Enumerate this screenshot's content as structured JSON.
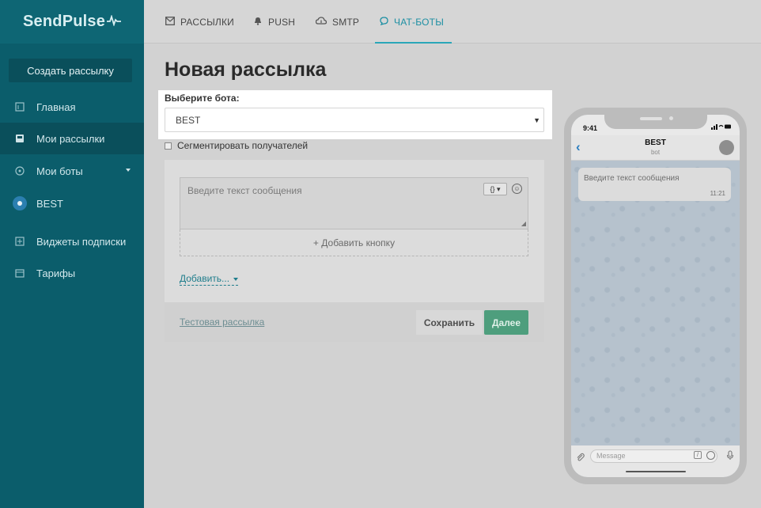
{
  "sidebar": {
    "logo": "SendPulse",
    "create_button": "Создать рассылку",
    "items": [
      {
        "label": "Главная",
        "icon": "home-icon"
      },
      {
        "label": "Мои рассылки",
        "icon": "inbox-icon",
        "active": true
      },
      {
        "label": "Мои боты",
        "icon": "bots-icon",
        "has_dropdown": true
      },
      {
        "label": "BEST",
        "icon": "bot-avatar"
      },
      {
        "label": "Виджеты подписки",
        "icon": "widget-icon"
      },
      {
        "label": "Тарифы",
        "icon": "tariff-icon"
      }
    ]
  },
  "topbar": {
    "tabs": [
      {
        "label": "РАССЫЛКИ",
        "icon": "mail-icon"
      },
      {
        "label": "PUSH",
        "icon": "bell-icon"
      },
      {
        "label": "SMTP",
        "icon": "cloud-icon"
      },
      {
        "label": "ЧАТ-БОТЫ",
        "icon": "chat-icon",
        "active": true
      }
    ]
  },
  "main": {
    "title": "Новая рассылка",
    "bot_select": {
      "label": "Выберите бота:",
      "value": "BEST"
    },
    "segment_label": "Сегментировать получателей",
    "editor": {
      "placeholder": "Введите текст сообщения",
      "var_button": "{}",
      "add_button": "+ Добавить кнопку",
      "add_more": "Добавить..."
    },
    "footer": {
      "test_link": "Тестовая рассылка",
      "save": "Сохранить",
      "next": "Далее"
    }
  },
  "preview": {
    "time": "9:41",
    "chat_title": "BEST",
    "chat_subtitle": "bot",
    "bubble_text": "Введите текст сообщения",
    "bubble_time": "11:21",
    "input_placeholder": "Message"
  },
  "colors": {
    "sidebar_bg": "#0b5d6b",
    "accent": "#1d8fa3",
    "next_button": "#4e9e7d"
  }
}
